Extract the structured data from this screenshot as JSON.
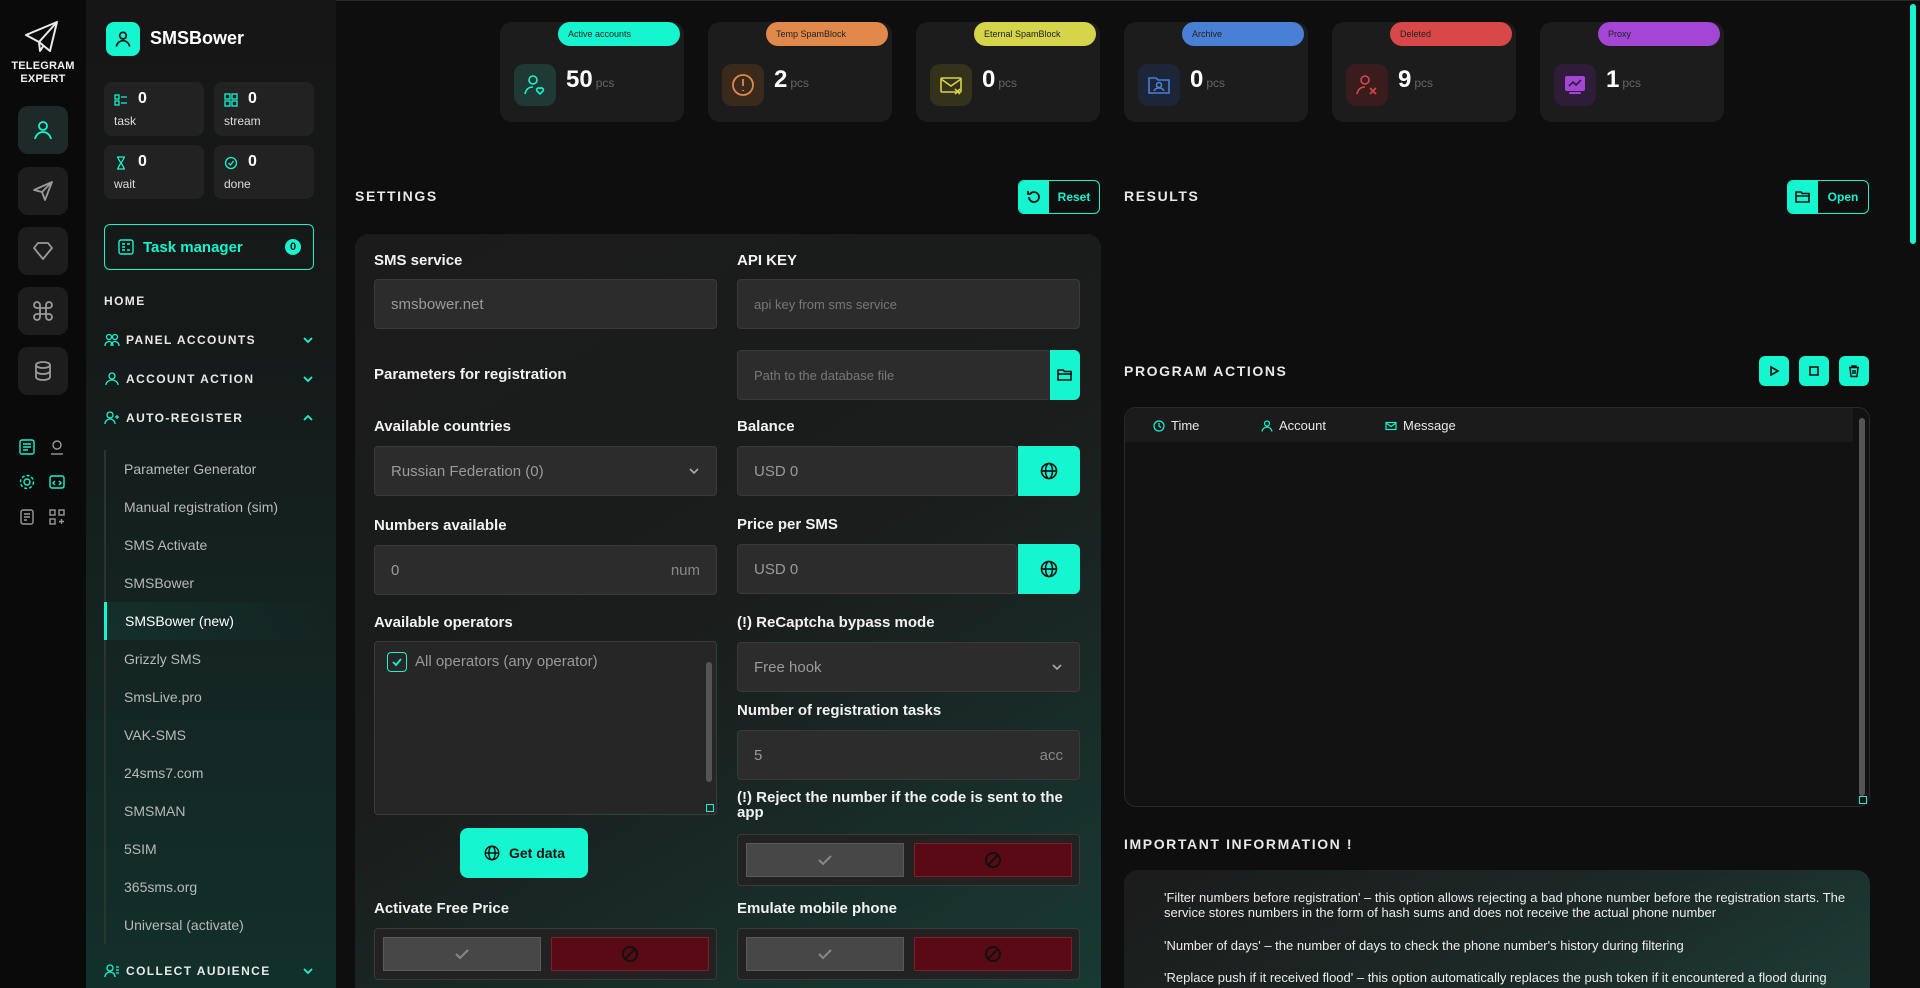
{
  "brand": {
    "line1": "TELEGRAM",
    "line2": "EXPERT"
  },
  "app": {
    "name": "SMSBower"
  },
  "stats": [
    {
      "label": "task",
      "value": "0",
      "icon": "task-icon"
    },
    {
      "label": "stream",
      "value": "0",
      "icon": "stream-icon"
    },
    {
      "label": "wait",
      "value": "0",
      "icon": "hourglass-icon"
    },
    {
      "label": "done",
      "value": "0",
      "icon": "check-circle-icon"
    }
  ],
  "task_manager": {
    "label": "Task manager",
    "count": "0"
  },
  "nav": {
    "home": "HOME",
    "panel_accounts": "PANEL ACCOUNTS",
    "account_action": "ACCOUNT ACTION",
    "auto_register": "AUTO-REGISTER",
    "collect_audience": "COLLECT AUDIENCE",
    "sub_items": [
      "Parameter Generator",
      "Manual registration (sim)",
      "SMS Activate",
      "SMSBower",
      "SMSBower (new)",
      "Grizzly SMS",
      "SmsLive.pro",
      "VAK-SMS",
      "24sms7.com",
      "SMSMAN",
      "5SIM",
      "365sms.org",
      "Universal (activate)"
    ],
    "active_index": 4
  },
  "top_cards": [
    {
      "tag": "Active accounts",
      "value": "50",
      "unit": "pcs",
      "tag_color": "#14f5d0",
      "icon": "user-heart-icon"
    },
    {
      "tag": "Temp SpamBlock",
      "value": "2",
      "unit": "pcs",
      "tag_color": "#e0894a",
      "icon": "warning-icon"
    },
    {
      "tag": "Eternal SpamBlock",
      "value": "0",
      "unit": "pcs",
      "tag_color": "#d6d44a",
      "icon": "mail-block-icon"
    },
    {
      "tag": "Archive",
      "value": "0",
      "unit": "pcs",
      "tag_color": "#4a7fd6",
      "icon": "archive-folder-icon"
    },
    {
      "tag": "Deleted",
      "value": "9",
      "unit": "pcs",
      "tag_color": "#d84848",
      "icon": "user-x-icon"
    },
    {
      "tag": "Proxy",
      "value": "1",
      "unit": "pcs",
      "tag_color": "#a545d6",
      "icon": "proxy-icon"
    }
  ],
  "settings": {
    "title": "SETTINGS",
    "reset_label": "Reset",
    "sms_service_label": "SMS service",
    "sms_service_value": "smsbower.net",
    "api_key_label": "API KEY",
    "api_key_placeholder": "api key from sms service",
    "params_label": "Parameters for registration",
    "db_path_placeholder": "Path to the database file",
    "countries_label": "Available countries",
    "countries_value": "Russian Federation (0)",
    "balance_label": "Balance",
    "balance_value": "USD  0",
    "numbers_label": "Numbers available",
    "numbers_value": "0",
    "numbers_suffix": "num",
    "price_label": "Price per SMS",
    "price_value": "USD  0",
    "operators_label": "Available operators",
    "operators_option": "All operators (any operator)",
    "recaptcha_label": "(!) ReCaptcha bypass mode",
    "recaptcha_value": "Free hook",
    "reg_tasks_label": "Number of registration tasks",
    "reg_tasks_value": "5",
    "reg_tasks_suffix": "acc",
    "reject_label": "(!) Reject the number if the code is sent to the app",
    "get_data_label": "Get data",
    "free_price_label": "Activate Free Price",
    "emulate_label": "Emulate mobile phone"
  },
  "results": {
    "title": "RESULTS",
    "open_label": "Open"
  },
  "program_actions": {
    "title": "PROGRAM ACTIONS",
    "columns": [
      "Time",
      "Account",
      "Message"
    ]
  },
  "info": {
    "title": "IMPORTANT INFORMATION !",
    "paragraphs": [
      "'Filter numbers before registration' – this option allows rejecting a bad phone number before the registration starts. The service stores numbers in the form of hash sums and does not receive the actual phone number",
      "'Number of days' – the number of days to check the phone number's history during filtering",
      "'Replace push if it received flood' – this option automatically replaces the push token if it encountered a flood during"
    ]
  },
  "colors": {
    "accent": "#14f5d0",
    "danger": "#5a0a14"
  }
}
